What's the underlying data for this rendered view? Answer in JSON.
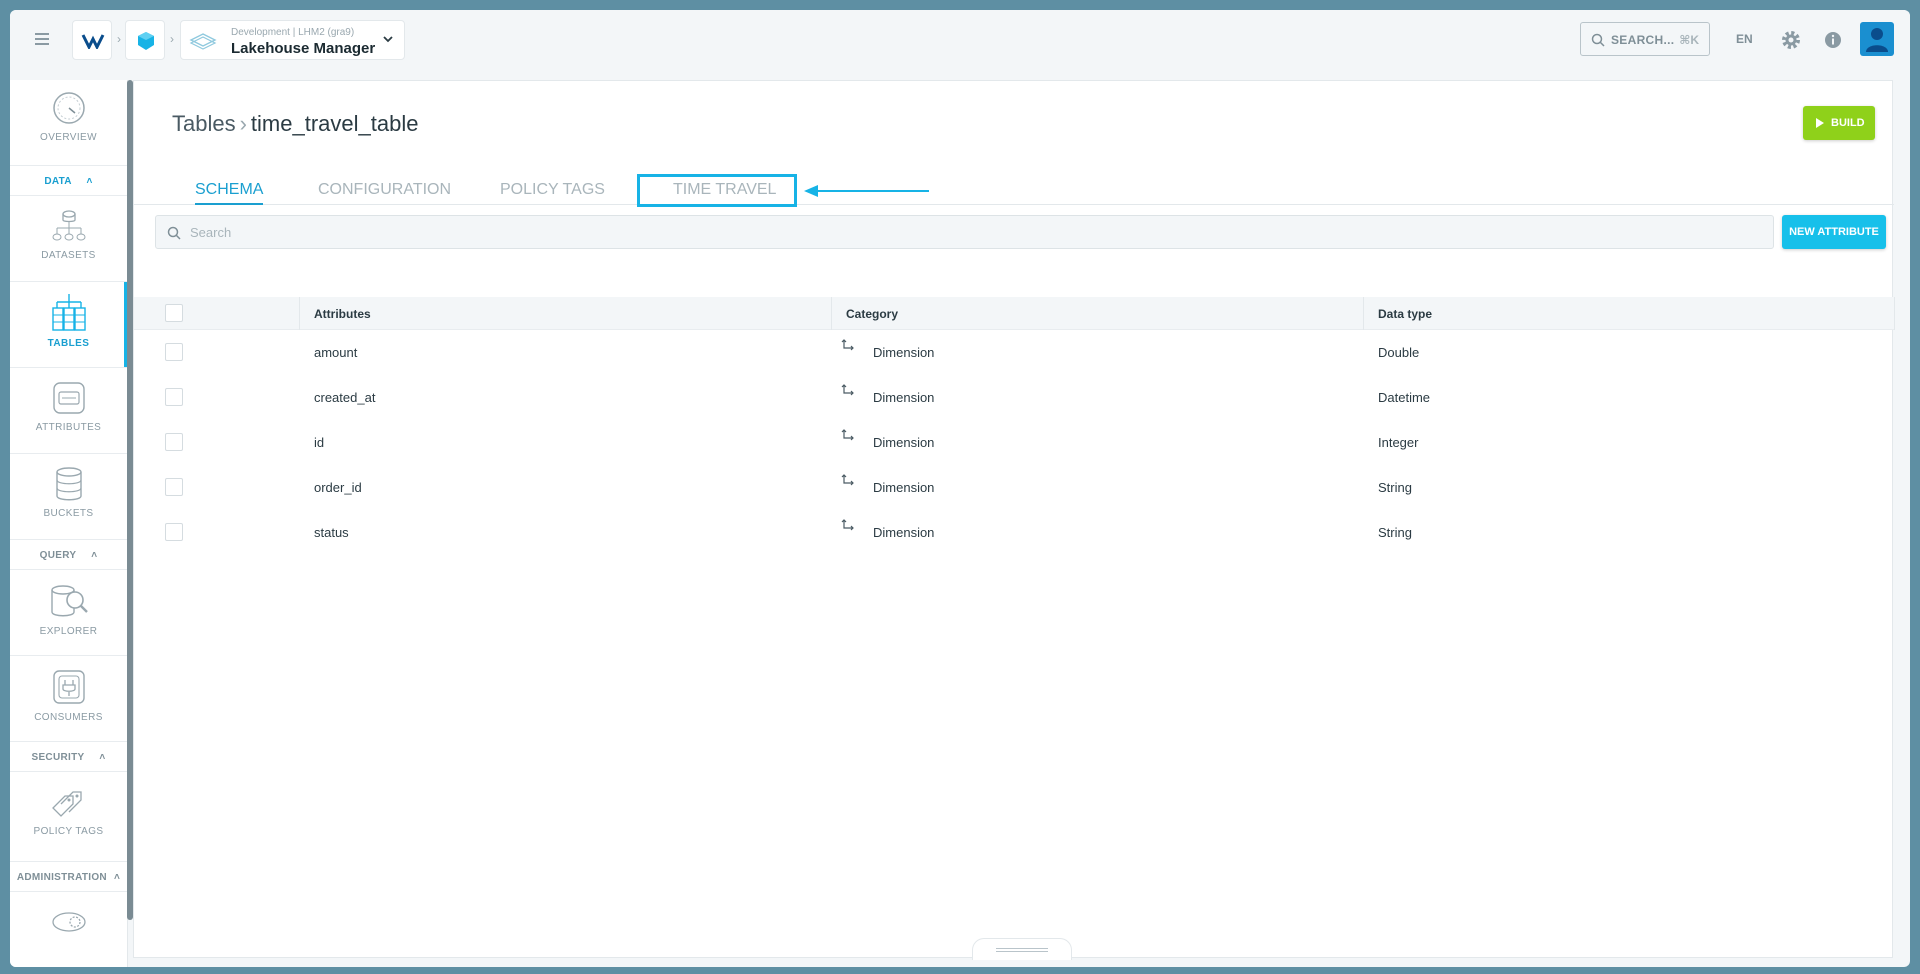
{
  "header": {
    "app_context": "Development | LHM2 (gra9)",
    "app_name": "Lakehouse Manager",
    "search_label": "SEARCH...",
    "search_shortcut": "⌘K",
    "language": "EN"
  },
  "sidebar": {
    "overview": "OVERVIEW",
    "sections": {
      "data": "DATA",
      "query": "QUERY",
      "security": "SECURITY",
      "administration": "ADMINISTRATION"
    },
    "items": {
      "datasets": "DATASETS",
      "tables": "TABLES",
      "attributes": "ATTRIBUTES",
      "buckets": "BUCKETS",
      "explorer": "EXPLORER",
      "consumers": "CONSUMERS",
      "policy_tags": "POLICY TAGS"
    }
  },
  "page": {
    "breadcrumb_root": "Tables",
    "breadcrumb_current": "time_travel_table",
    "build_label": "BUILD",
    "tabs": [
      "SCHEMA",
      "CONFIGURATION",
      "POLICY TAGS",
      "TIME TRAVEL"
    ],
    "search_placeholder": "Search",
    "new_attribute_label": "NEW ATTRIBUTE"
  },
  "table": {
    "columns": [
      "Attributes",
      "Category",
      "Data type"
    ],
    "rows": [
      {
        "attribute": "amount",
        "category": "Dimension",
        "data_type": "Double"
      },
      {
        "attribute": "created_at",
        "category": "Dimension",
        "data_type": "Datetime"
      },
      {
        "attribute": "id",
        "category": "Dimension",
        "data_type": "Integer"
      },
      {
        "attribute": "order_id",
        "category": "Dimension",
        "data_type": "String"
      },
      {
        "attribute": "status",
        "category": "Dimension",
        "data_type": "String"
      }
    ]
  },
  "colors": {
    "accent": "#17b3e6",
    "build": "#8fd11a",
    "new_attribute": "#17c0ea"
  }
}
